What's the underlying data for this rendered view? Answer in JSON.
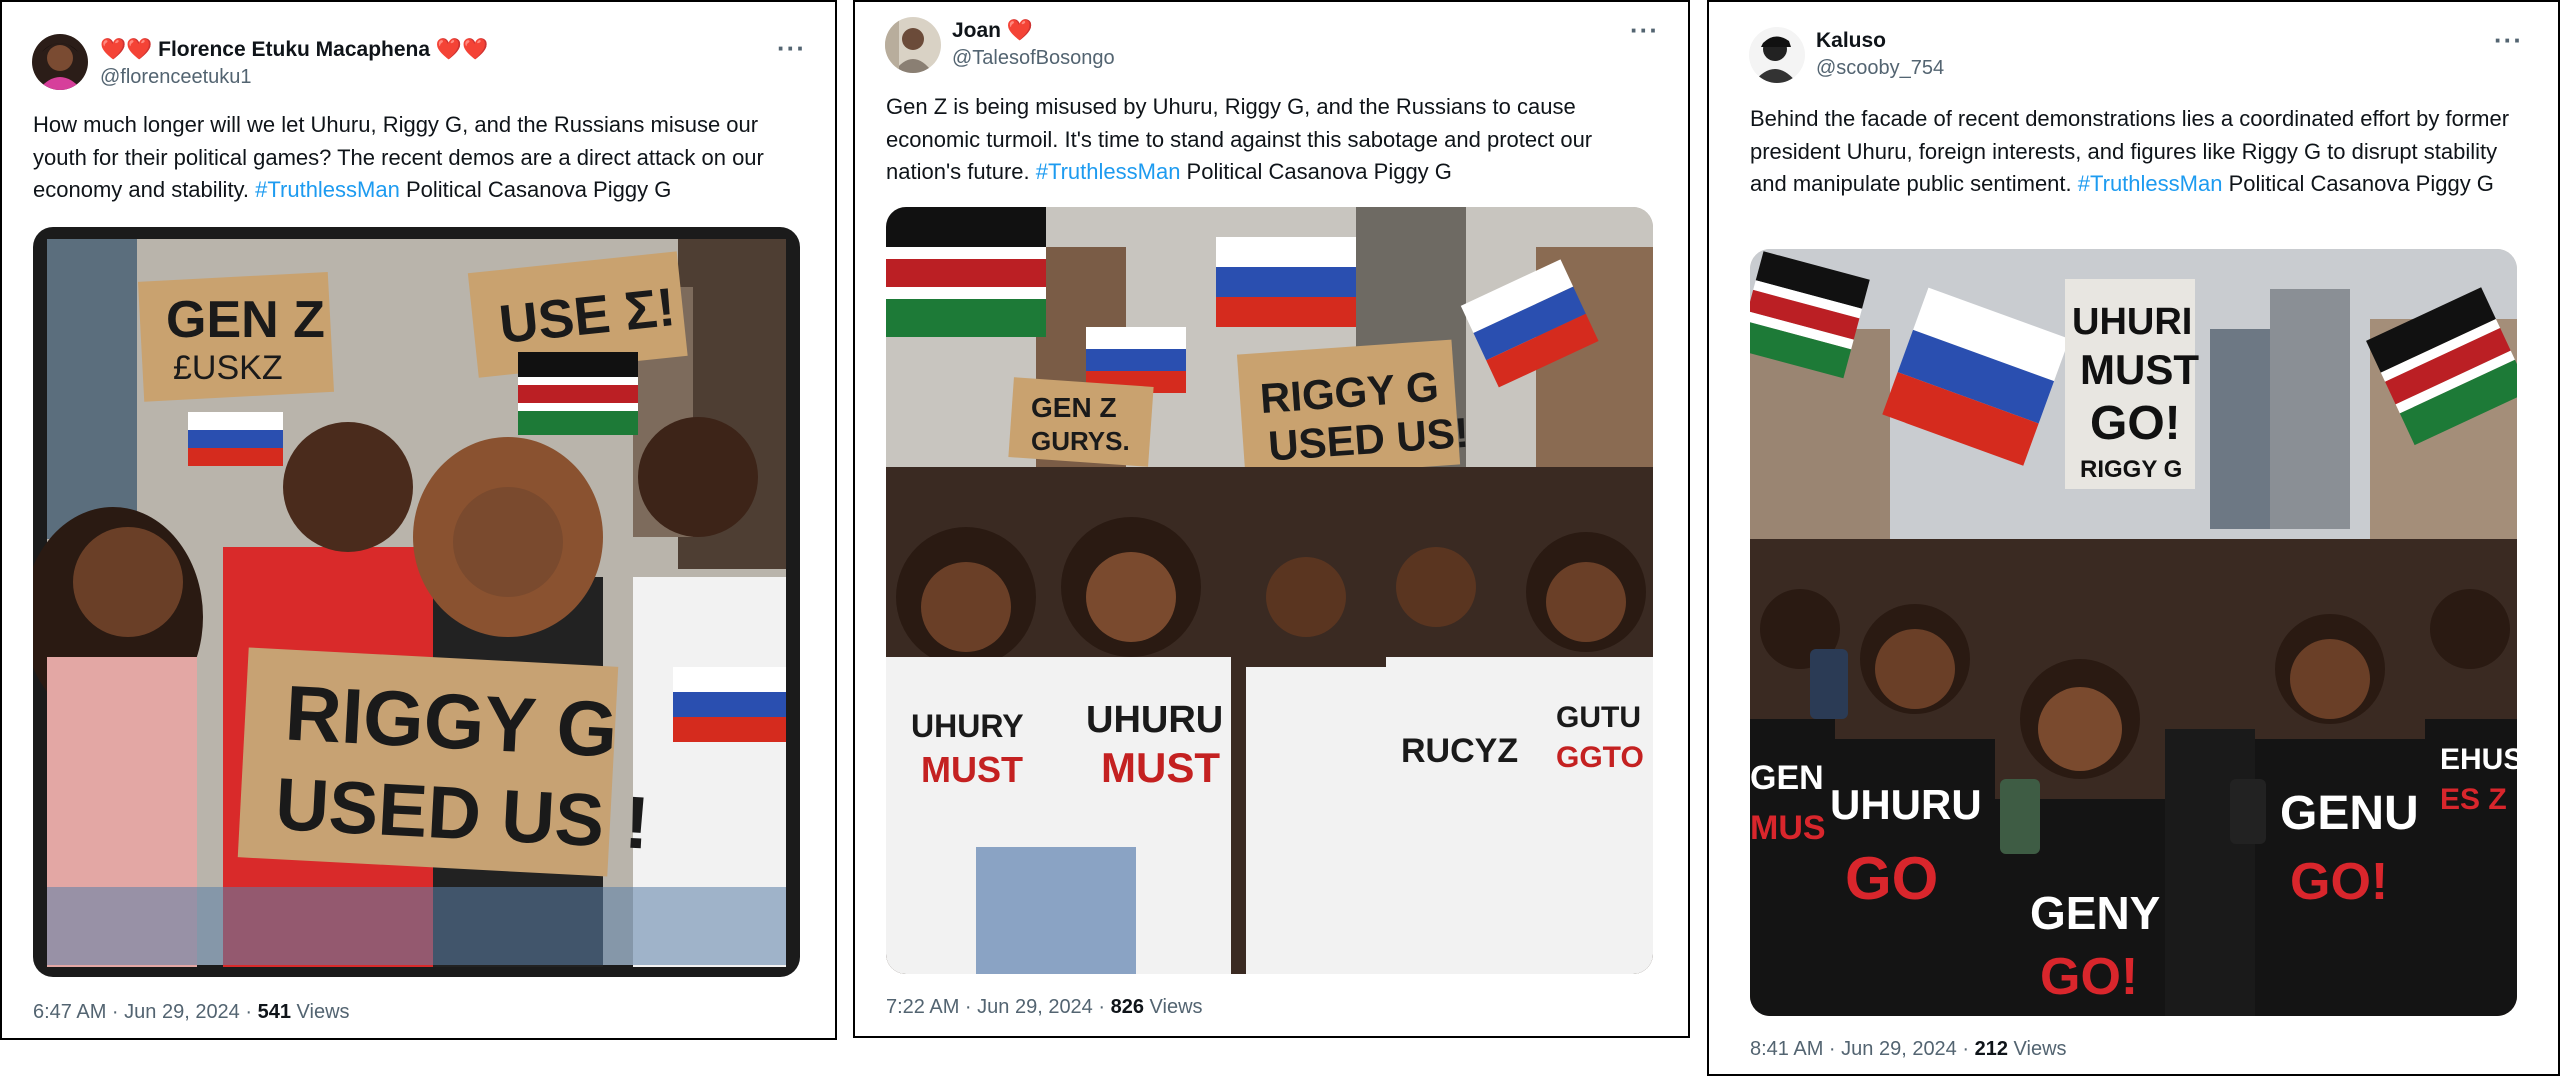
{
  "tweets": [
    {
      "name_prefix": "❤️❤️",
      "name": "Florence Etuku Macaphena",
      "name_suffix": "❤️❤️",
      "handle": "@florenceetuku1",
      "text_pre": "How much longer will we let Uhuru, Riggy G, and the Russians misuse our youth for their political games? The recent demos are a direct attack on our economy and stability. ",
      "hashtag": "#TruthlessMan",
      "text_post": " Political Casanova Piggy G",
      "time": "6:47 AM · Jun 29, 2024 · ",
      "views": "541",
      "views_label": " Views",
      "image_signs": [
        "GEN Z",
        "£USKZ",
        "USE Σ!",
        "RIGGY G",
        "USED US !"
      ]
    },
    {
      "name": "Joan",
      "name_suffix": "❤️",
      "handle": "@TalesofBosongo",
      "text_pre": "Gen Z is being misused by Uhuru, Riggy G, and the Russians to cause economic turmoil. It's time to stand against this sabotage and protect our nation's future. ",
      "hashtag": "#TruthlessMan",
      "text_post": " Political Casanova Piggy G",
      "time": "7:22 AM · Jun 29, 2024 · ",
      "views": "826",
      "views_label": " Views",
      "image_signs": [
        "GEN Z",
        "GURYS.",
        "RIGGY G",
        "USED US!",
        "UHURY",
        "MUST",
        "UHURU",
        "MUST",
        "RUCYZ",
        "GUTU",
        "GGTO"
      ]
    },
    {
      "name": "Kaluso",
      "handle": "@scooby_754",
      "text_pre": "Behind the facade of recent demonstrations lies a coordinated effort by former president Uhuru, foreign interests, and figures like Riggy G to disrupt stability and manipulate public sentiment. ",
      "hashtag": "#TruthlessMan",
      "text_post": " Political Casanova Piggy G",
      "time": "8:41 AM · Jun 29, 2024 · ",
      "views": "212",
      "views_label": " Views",
      "image_signs": [
        "UHURI",
        "MUST",
        "GO!",
        "RIGGY G",
        "UHURU",
        "GO",
        "GENU",
        "GO!",
        "GENY",
        "GO!",
        "GEN",
        "MUS",
        "EHUS",
        "ES Z"
      ]
    }
  ],
  "more_icon": "more-horizontal-icon",
  "colors": {
    "link": "#1d9bf0",
    "secondary": "#536471",
    "text": "#0f1419"
  }
}
